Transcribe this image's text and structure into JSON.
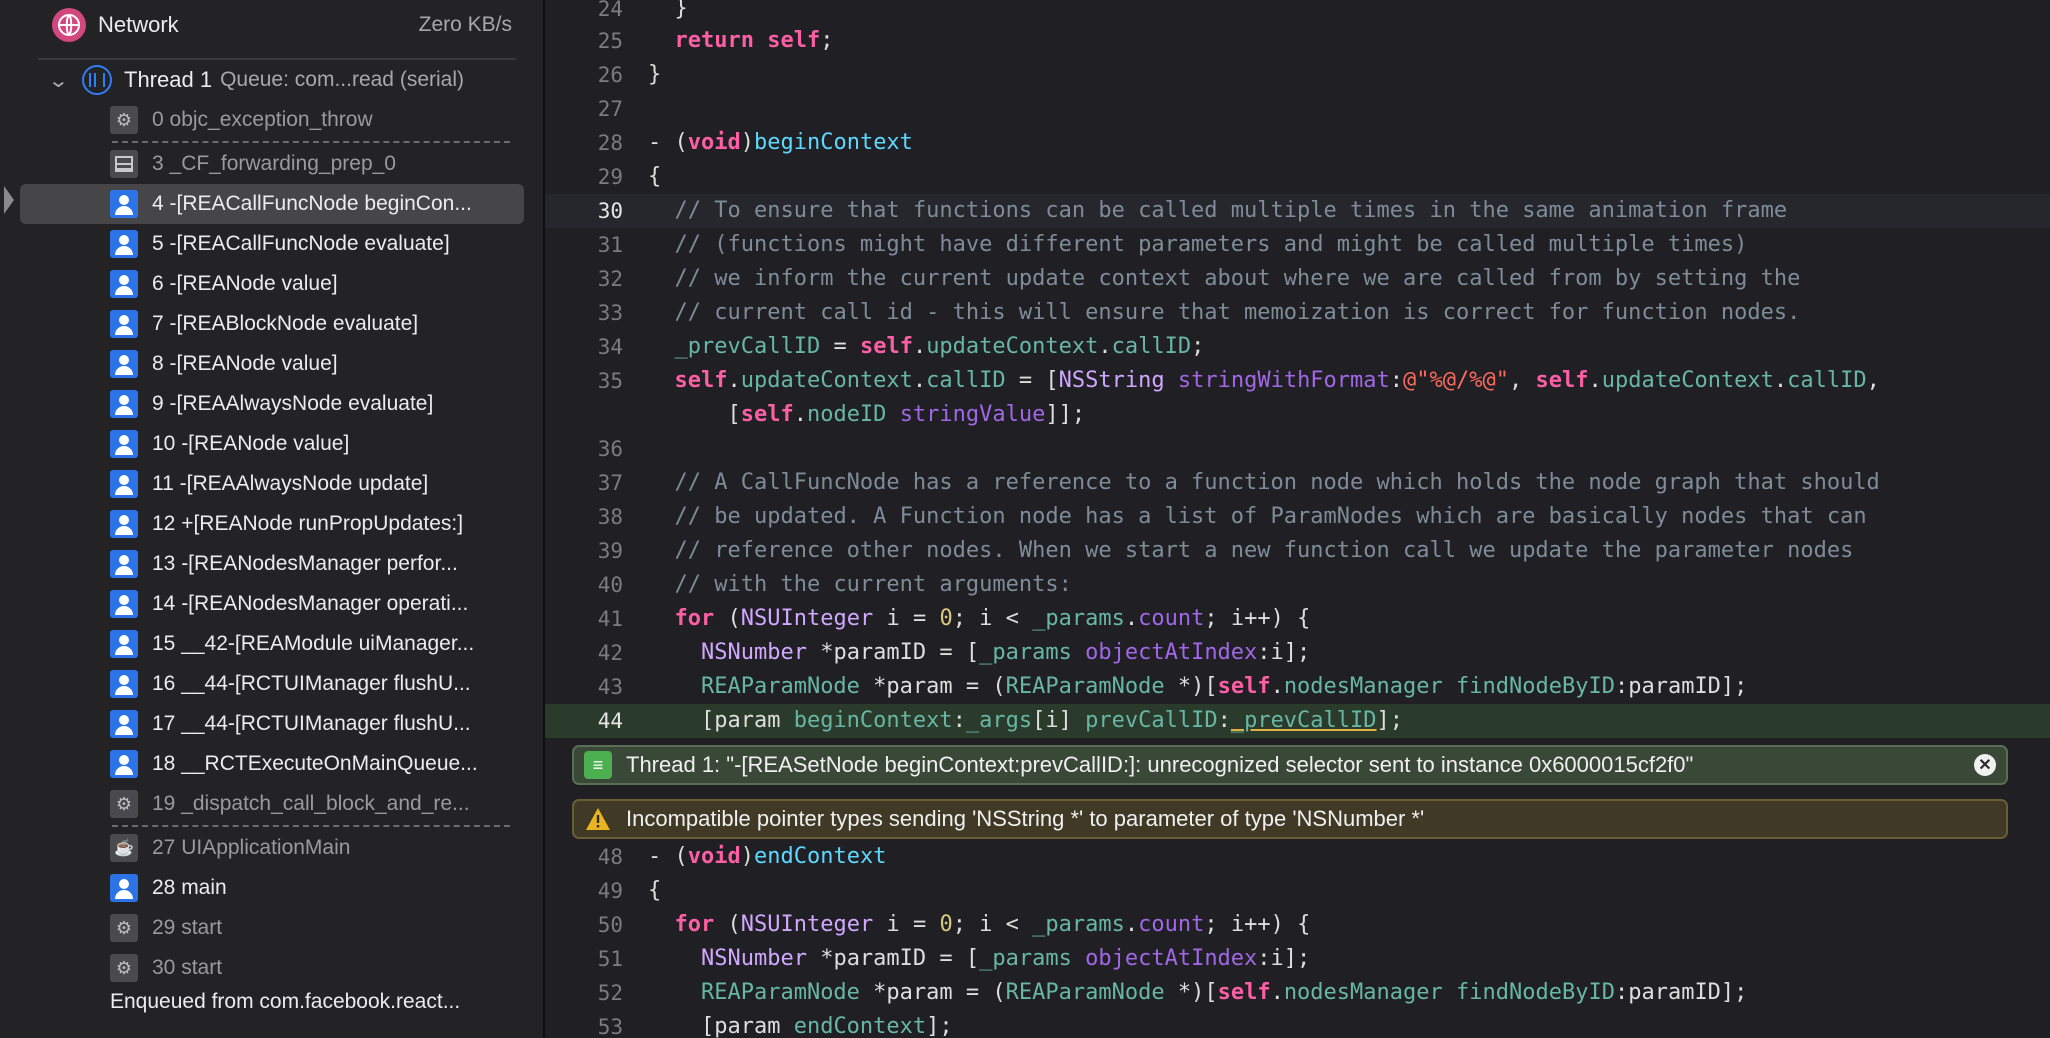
{
  "navigator": {
    "gauge": {
      "label": "Network",
      "value": "Zero KB/s"
    },
    "thread": {
      "name": "Thread 1",
      "queue": "Queue: com...read (serial)"
    },
    "frames": [
      {
        "label": "0 objc_exception_throw",
        "icon": "gear-icon",
        "kind": "sys"
      },
      {
        "label": "3 _CF_forwarding_prep_0",
        "icon": "grid-icon",
        "kind": "grid"
      },
      {
        "label": "4 -[REACallFuncNode beginCon...",
        "icon": "user-code-icon",
        "kind": "user",
        "selected": true
      },
      {
        "label": "5 -[REACallFuncNode evaluate]",
        "icon": "user-code-icon",
        "kind": "user"
      },
      {
        "label": "6 -[REANode value]",
        "icon": "user-code-icon",
        "kind": "user"
      },
      {
        "label": "7 -[REABlockNode evaluate]",
        "icon": "user-code-icon",
        "kind": "user"
      },
      {
        "label": "8 -[REANode value]",
        "icon": "user-code-icon",
        "kind": "user"
      },
      {
        "label": "9 -[REAAlwaysNode evaluate]",
        "icon": "user-code-icon",
        "kind": "user"
      },
      {
        "label": "10 -[REANode value]",
        "icon": "user-code-icon",
        "kind": "user"
      },
      {
        "label": "11 -[REAAlwaysNode update]",
        "icon": "user-code-icon",
        "kind": "user"
      },
      {
        "label": "12 +[REANode runPropUpdates:]",
        "icon": "user-code-icon",
        "kind": "user"
      },
      {
        "label": "13 -[REANodesManager perfor...",
        "icon": "user-code-icon",
        "kind": "user"
      },
      {
        "label": "14 -[REANodesManager operati...",
        "icon": "user-code-icon",
        "kind": "user"
      },
      {
        "label": "15 __42-[REAModule uiManager...",
        "icon": "user-code-icon",
        "kind": "user"
      },
      {
        "label": "16 __44-[RCTUIManager flushU...",
        "icon": "user-code-icon",
        "kind": "user"
      },
      {
        "label": "17 __44-[RCTUIManager flushU...",
        "icon": "user-code-icon",
        "kind": "user"
      },
      {
        "label": "18 __RCTExecuteOnMainQueue...",
        "icon": "user-code-icon",
        "kind": "user"
      },
      {
        "label": "19 _dispatch_call_block_and_re...",
        "icon": "gear-icon",
        "kind": "sys"
      },
      {
        "label": "27 UIApplicationMain",
        "icon": "cup-icon",
        "kind": "cup"
      },
      {
        "label": "28 main",
        "icon": "user-code-icon",
        "kind": "user"
      },
      {
        "label": "29 start",
        "icon": "gear-icon",
        "kind": "sys"
      },
      {
        "label": "30 start",
        "icon": "gear-icon",
        "kind": "sys"
      }
    ],
    "enqueued": "Enqueued from com.facebook.react..."
  },
  "editor": {
    "current_line": "30",
    "error_line": "44",
    "lines": [
      {
        "n": "24"
      },
      {
        "n": "25"
      },
      {
        "n": "26"
      },
      {
        "n": "27"
      },
      {
        "n": "28"
      },
      {
        "n": "29"
      },
      {
        "n": "30"
      },
      {
        "n": "31"
      },
      {
        "n": "32"
      },
      {
        "n": "33"
      },
      {
        "n": "34"
      },
      {
        "n": "35"
      },
      {
        "n": "36"
      },
      {
        "n": "37"
      },
      {
        "n": "38"
      },
      {
        "n": "39"
      },
      {
        "n": "40"
      },
      {
        "n": "41"
      },
      {
        "n": "42"
      },
      {
        "n": "43"
      },
      {
        "n": "44"
      },
      {
        "n": "48"
      },
      {
        "n": "49"
      },
      {
        "n": "50"
      },
      {
        "n": "51"
      },
      {
        "n": "52"
      },
      {
        "n": "53"
      }
    ],
    "comments": {
      "c30": "// To ensure that functions can be called multiple times in the same animation frame",
      "c31": "// (functions might have different parameters and might be called multiple times)",
      "c32": "// we inform the current update context about where we are called from by setting the",
      "c33": "// current call id - this will ensure that memoization is correct for function nodes.",
      "c37": "// A CallFuncNode has a reference to a function node which holds the node graph that should",
      "c38": "// be updated. A Function node has a list of ParamNodes which are basically nodes that can",
      "c39": "// reference other nodes. When we start a new function call we update the parameter nodes",
      "c40": "// with the current arguments:"
    },
    "issues": {
      "error": "Thread 1: \"-[REASetNode beginContext:prevCallID:]: unrecognized selector sent to instance 0x6000015cf2f0\"",
      "warning": "Incompatible pointer types sending 'NSString *' to parameter of type 'NSNumber *'"
    }
  },
  "colors": {
    "keyword": "#fc5fa3",
    "comment": "#7f8c98",
    "member": "#67b7a4",
    "method": "#a167e6",
    "string": "#fc6a5d",
    "number": "#d9c97c",
    "error_banner": "#3a4838",
    "warning_banner": "#3f3925",
    "selection": "#464649"
  }
}
